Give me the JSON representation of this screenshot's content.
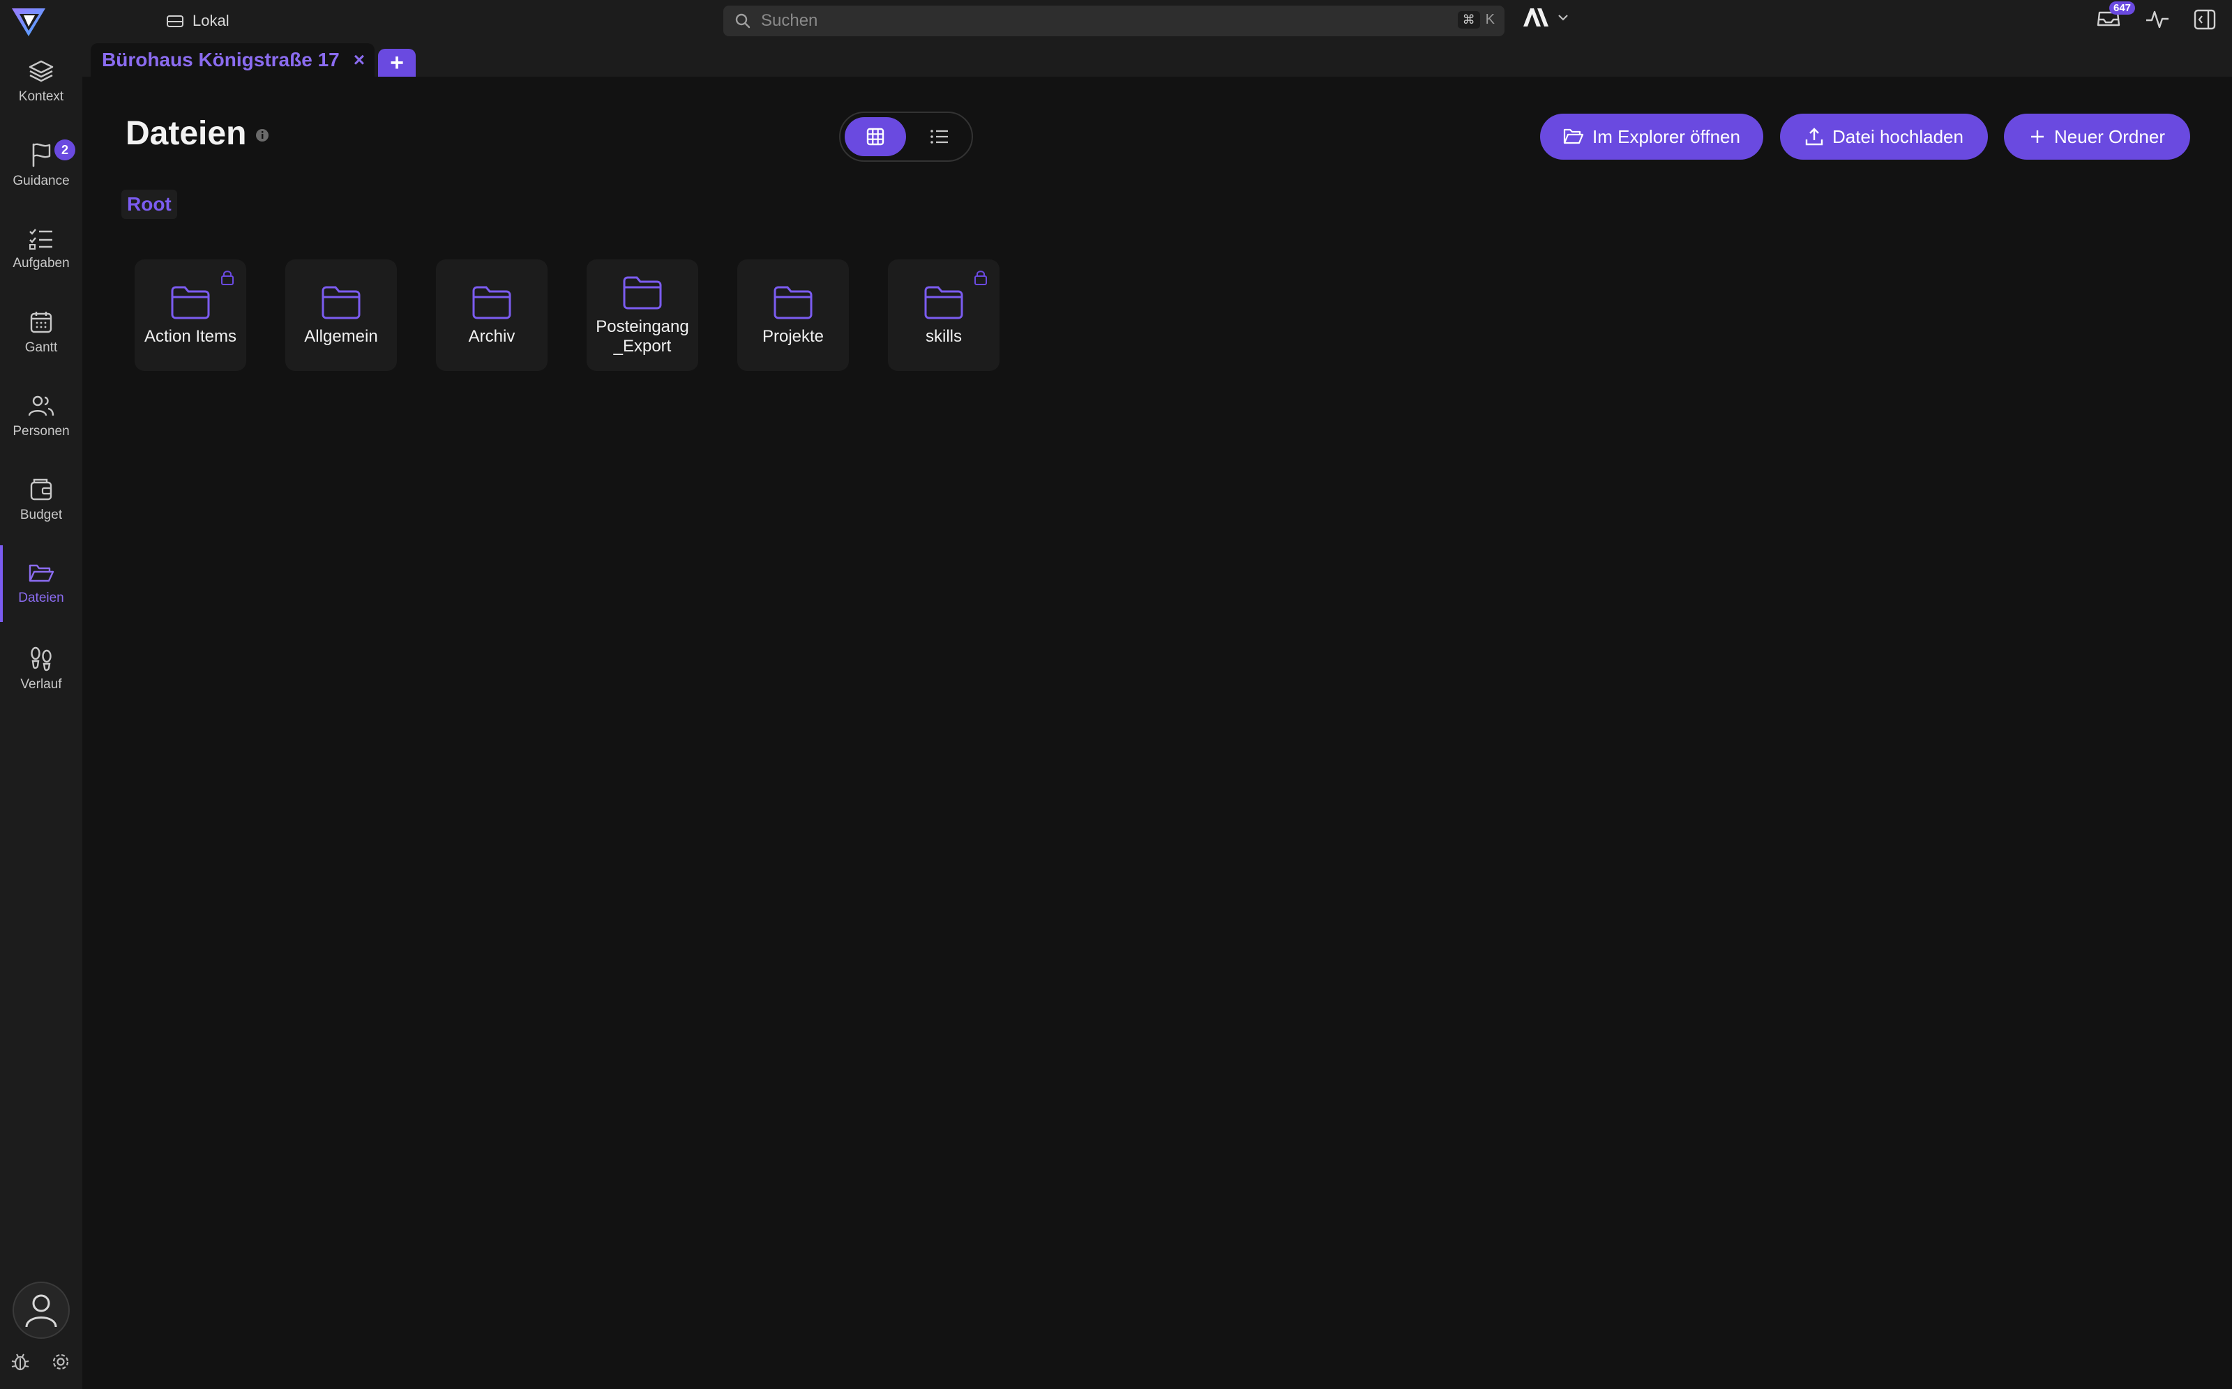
{
  "topbar": {
    "workspace_label": "Lokal",
    "search_placeholder": "Suchen",
    "shortcut_symbol": "⌘",
    "shortcut_key": "K",
    "inbox_count": "647"
  },
  "sidebar": {
    "items": [
      {
        "label": "Kontext",
        "icon": "layers-icon"
      },
      {
        "label": "Guidance",
        "icon": "flag-icon",
        "badge": "2"
      },
      {
        "label": "Aufgaben",
        "icon": "checklist-icon"
      },
      {
        "label": "Gantt",
        "icon": "calendar-icon"
      },
      {
        "label": "Personen",
        "icon": "users-icon"
      },
      {
        "label": "Budget",
        "icon": "wallet-icon"
      },
      {
        "label": "Dateien",
        "icon": "folder-open-icon",
        "active": true
      },
      {
        "label": "Verlauf",
        "icon": "footprints-icon"
      }
    ]
  },
  "tabs": {
    "active_label": "Bürohaus Königstraße 17",
    "close_glyph": "×",
    "add_glyph": "+"
  },
  "main": {
    "title": "Dateien",
    "breadcrumb": "Root",
    "buttons": {
      "open_explorer": "Im Explorer öffnen",
      "upload": "Datei hochladen",
      "new_folder": "Neuer Ordner"
    },
    "folders": [
      {
        "name": "Action Items",
        "locked": true
      },
      {
        "name": "Allgemein",
        "locked": false
      },
      {
        "name": "Archiv",
        "locked": false
      },
      {
        "name": "Posteingang\n_Export",
        "locked": false
      },
      {
        "name": "Projekte",
        "locked": false
      },
      {
        "name": "skills",
        "locked": true
      }
    ]
  },
  "colors": {
    "accent": "#6a4ae0",
    "accent_text": "#8b6cf0",
    "background": "#121212",
    "panel": "#1c1c1c"
  }
}
